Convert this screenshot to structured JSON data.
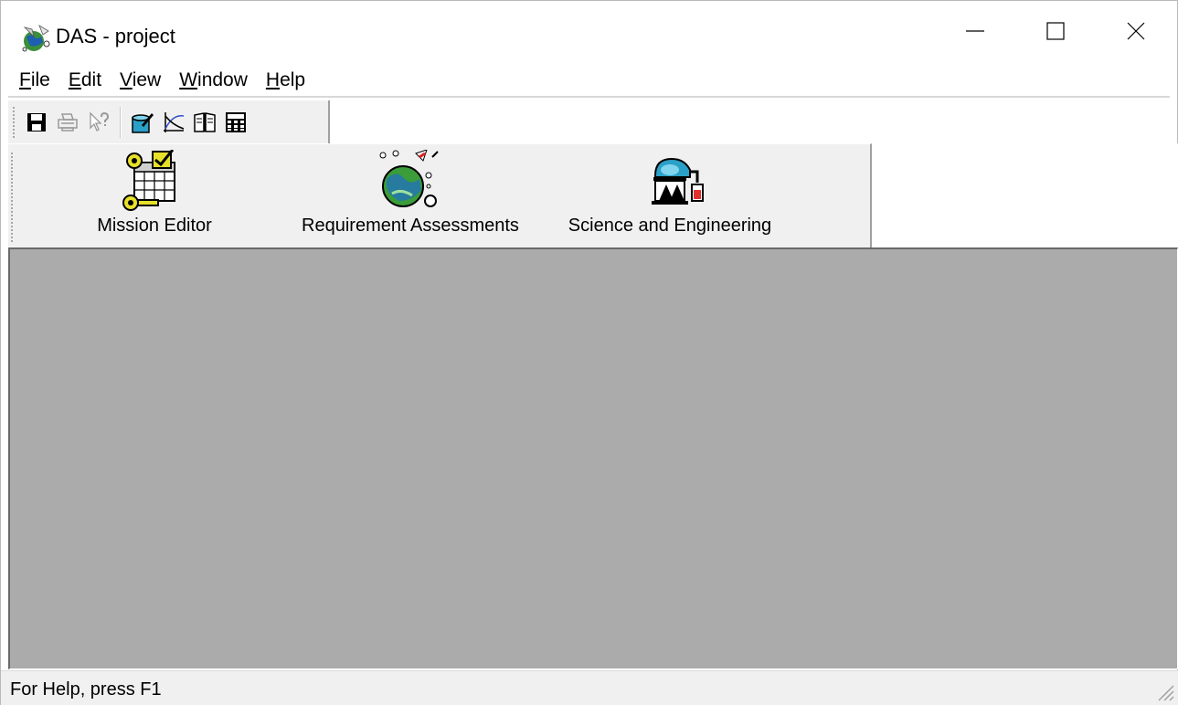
{
  "window": {
    "title": "DAS - project",
    "app_icon": "das-globe-icon"
  },
  "title_buttons": {
    "minimize": "minimize-icon",
    "maximize": "maximize-icon",
    "close": "close-icon"
  },
  "menu": {
    "items": [
      {
        "label_underlined": "F",
        "label_rest": "ile"
      },
      {
        "label_underlined": "E",
        "label_rest": "dit"
      },
      {
        "label_underlined": "V",
        "label_rest": "iew"
      },
      {
        "label_underlined": "W",
        "label_rest": "indow"
      },
      {
        "label_underlined": "H",
        "label_rest": "elp"
      }
    ]
  },
  "toolbar": {
    "icons": [
      "save-icon",
      "print-icon",
      "context-help-icon",
      "edit-object-icon",
      "chart-icon",
      "book-icon",
      "calculator-icon"
    ]
  },
  "modules": {
    "mission_editor": "Mission Editor",
    "requirement_assessments": "Requirement Assessments",
    "science_engineering": "Science and Engineering"
  },
  "status": {
    "text": "For Help, press F1"
  },
  "colors": {
    "mdi_background": "#ababab",
    "toolbar_background": "#f0f0f0"
  }
}
